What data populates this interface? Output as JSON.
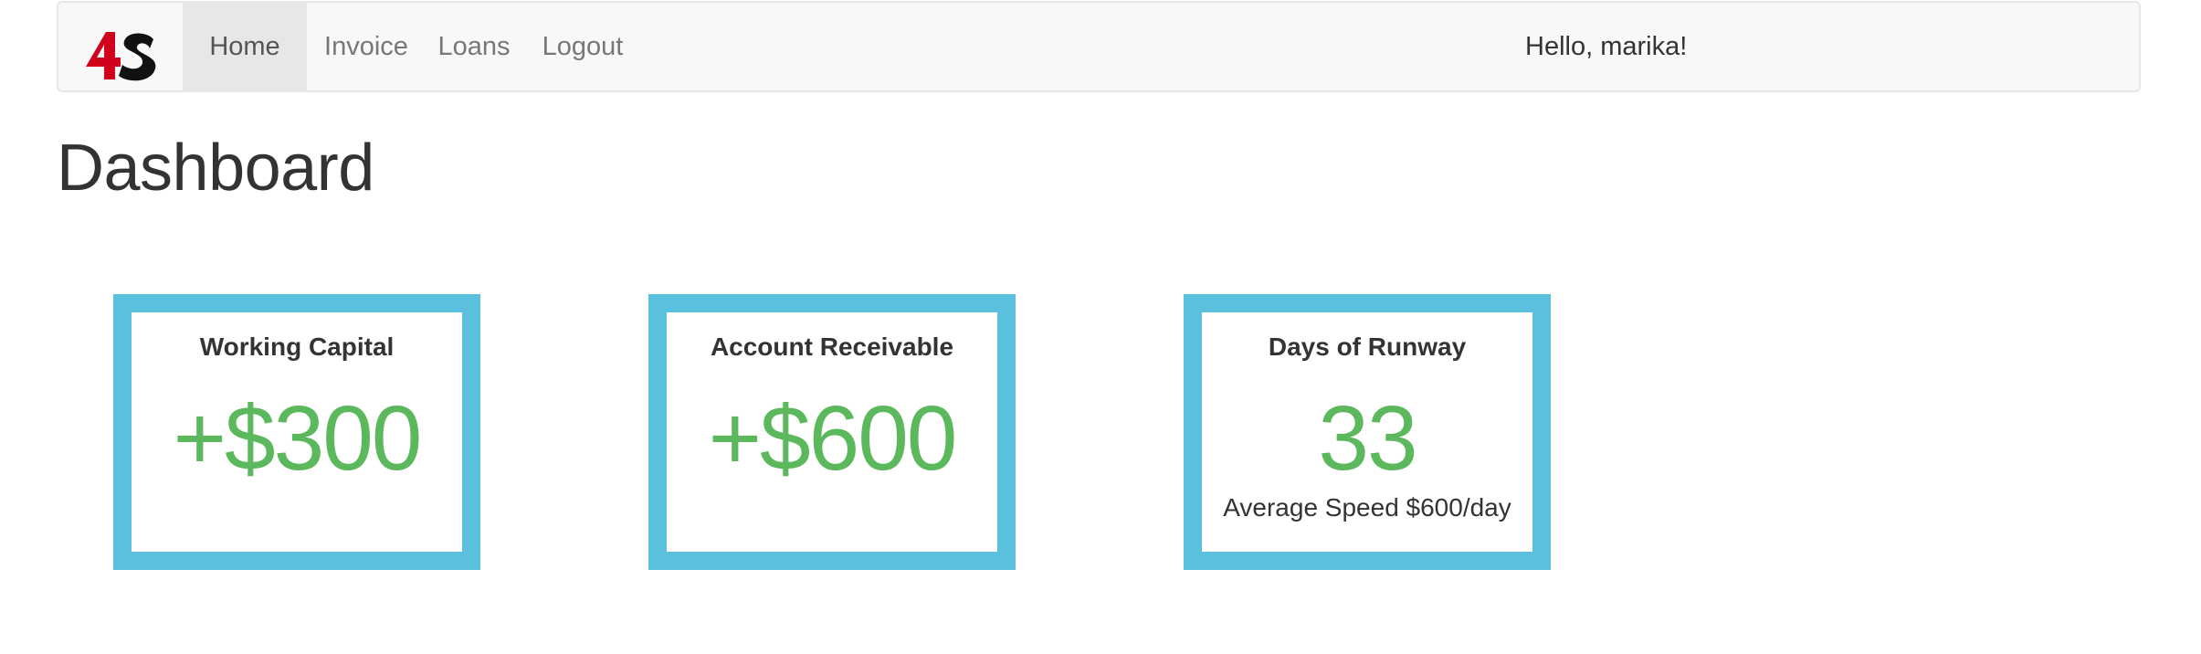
{
  "app": {
    "logo_text": "4S",
    "colors": {
      "logo_red": "#d0021b",
      "logo_black": "#111111",
      "accent_blue": "#5bc0de",
      "positive_green": "#5cb85c"
    }
  },
  "nav": {
    "items": [
      {
        "label": "Home",
        "active": true
      },
      {
        "label": "Invoice",
        "active": false
      },
      {
        "label": "Loans",
        "active": false
      },
      {
        "label": "Logout",
        "active": false
      }
    ],
    "greeting": "Hello, marika!"
  },
  "page": {
    "title": "Dashboard"
  },
  "cards": [
    {
      "title": "Working Capital",
      "value": "+$300",
      "subtitle": ""
    },
    {
      "title": "Account Receivable",
      "value": "+$600",
      "subtitle": ""
    },
    {
      "title": "Days of Runway",
      "value": "33",
      "subtitle": "Average Speed $600/day"
    }
  ]
}
